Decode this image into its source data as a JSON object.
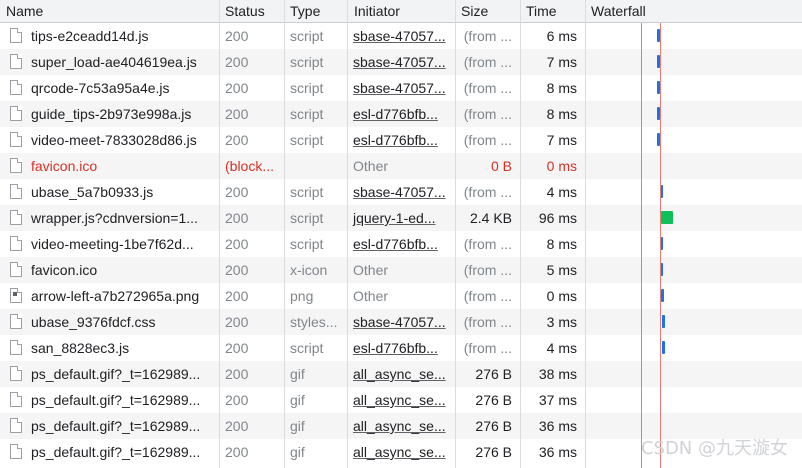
{
  "columns": {
    "name": "Name",
    "status": "Status",
    "type": "Type",
    "initiator": "Initiator",
    "size": "Size",
    "time": "Time",
    "waterfall": "Waterfall"
  },
  "colors": {
    "blue_bar": "#1a73e8",
    "green_bar": "#0fbf5b",
    "dom_line": "#8e8cf7",
    "load_line": "#ee7b72",
    "blocked_text": "#d93025"
  },
  "rows": [
    {
      "name": "tips-e2ceadd14d.js",
      "status": "200",
      "type": "script",
      "initiator": "sbase-47057...",
      "size": "(from ...",
      "time": "6 ms",
      "icon": "file-icon",
      "wf_start": 0.0,
      "wf_ms": 6
    },
    {
      "name": "super_load-ae404619ea.js",
      "status": "200",
      "type": "script",
      "initiator": "sbase-47057...",
      "size": "(from ...",
      "time": "7 ms",
      "icon": "file-icon",
      "wf_start": 0.0,
      "wf_ms": 7
    },
    {
      "name": "qrcode-7c53a95a4e.js",
      "status": "200",
      "type": "script",
      "initiator": "sbase-47057...",
      "size": "(from ...",
      "time": "8 ms",
      "icon": "file-icon",
      "wf_start": 0.0,
      "wf_ms": 8
    },
    {
      "name": "guide_tips-2b973e998a.js",
      "status": "200",
      "type": "script",
      "initiator": "esl-d776bfb...",
      "size": "(from ...",
      "time": "8 ms",
      "icon": "file-icon",
      "wf_start": 0.0,
      "wf_ms": 8
    },
    {
      "name": "video-meet-7833028d86.js",
      "status": "200",
      "type": "script",
      "initiator": "esl-d776bfb...",
      "size": "(from ...",
      "time": "7 ms",
      "icon": "file-icon",
      "wf_start": 0.0,
      "wf_ms": 7
    },
    {
      "name": "favicon.ico",
      "status": "(block...",
      "type": "",
      "initiator": "Other",
      "size": "0 B",
      "time": "0 ms",
      "icon": "file-icon",
      "blocked": true
    },
    {
      "name": "ubase_5a7b0933.js",
      "status": "200",
      "type": "script",
      "initiator": "sbase-47057...",
      "size": "(from ...",
      "time": "4 ms",
      "icon": "file-icon",
      "wf_start": 0.3,
      "wf_ms": 4
    },
    {
      "name": "wrapper.js?cdnversion=1...",
      "status": "200",
      "type": "script",
      "initiator": "jquery-1-ed...",
      "size": "2.4 KB",
      "time": "96 ms",
      "icon": "file-icon",
      "wf_start": 0.35,
      "wf_ms": 96,
      "green": true
    },
    {
      "name": "video-meeting-1be7f62d...",
      "status": "200",
      "type": "script",
      "initiator": "esl-d776bfb...",
      "size": "(from ...",
      "time": "8 ms",
      "icon": "file-icon",
      "wf_start": 0.3,
      "wf_ms": 8
    },
    {
      "name": "favicon.ico",
      "status": "200",
      "type": "x-icon",
      "initiator": "Other",
      "size": "(from ...",
      "time": "5 ms",
      "icon": "file-icon",
      "wf_start": 0.3,
      "wf_ms": 5
    },
    {
      "name": "arrow-left-a7b272965a.png",
      "status": "200",
      "type": "png",
      "initiator": "Other",
      "size": "(from ...",
      "time": "0 ms",
      "icon": "image-file-icon",
      "wf_start": 0.4,
      "wf_ms": 1
    },
    {
      "name": "ubase_9376fdcf.css",
      "status": "200",
      "type": "styles...",
      "initiator": "sbase-47057...",
      "size": "(from ...",
      "time": "3 ms",
      "icon": "file-icon",
      "wf_start": 0.45,
      "wf_ms": 3
    },
    {
      "name": "san_8828ec3.js",
      "status": "200",
      "type": "script",
      "initiator": "esl-d776bfb...",
      "size": "(from ...",
      "time": "4 ms",
      "icon": "file-icon",
      "wf_start": 0.5,
      "wf_ms": 4
    },
    {
      "name": "ps_default.gif?_t=162989...",
      "status": "200",
      "type": "gif",
      "initiator": "all_async_se...",
      "size": "276 B",
      "time": "38 ms",
      "icon": "file-icon"
    },
    {
      "name": "ps_default.gif?_t=162989...",
      "status": "200",
      "type": "gif",
      "initiator": "all_async_se...",
      "size": "276 B",
      "time": "37 ms",
      "icon": "file-icon"
    },
    {
      "name": "ps_default.gif?_t=162989...",
      "status": "200",
      "type": "gif",
      "initiator": "all_async_se...",
      "size": "276 B",
      "time": "36 ms",
      "icon": "file-icon"
    },
    {
      "name": "ps_default.gif?_t=162989...",
      "status": "200",
      "type": "gif",
      "initiator": "all_async_se...",
      "size": "276 B",
      "time": "36 ms",
      "icon": "file-icon"
    }
  ],
  "watermark": "CSDN @九天漩女"
}
